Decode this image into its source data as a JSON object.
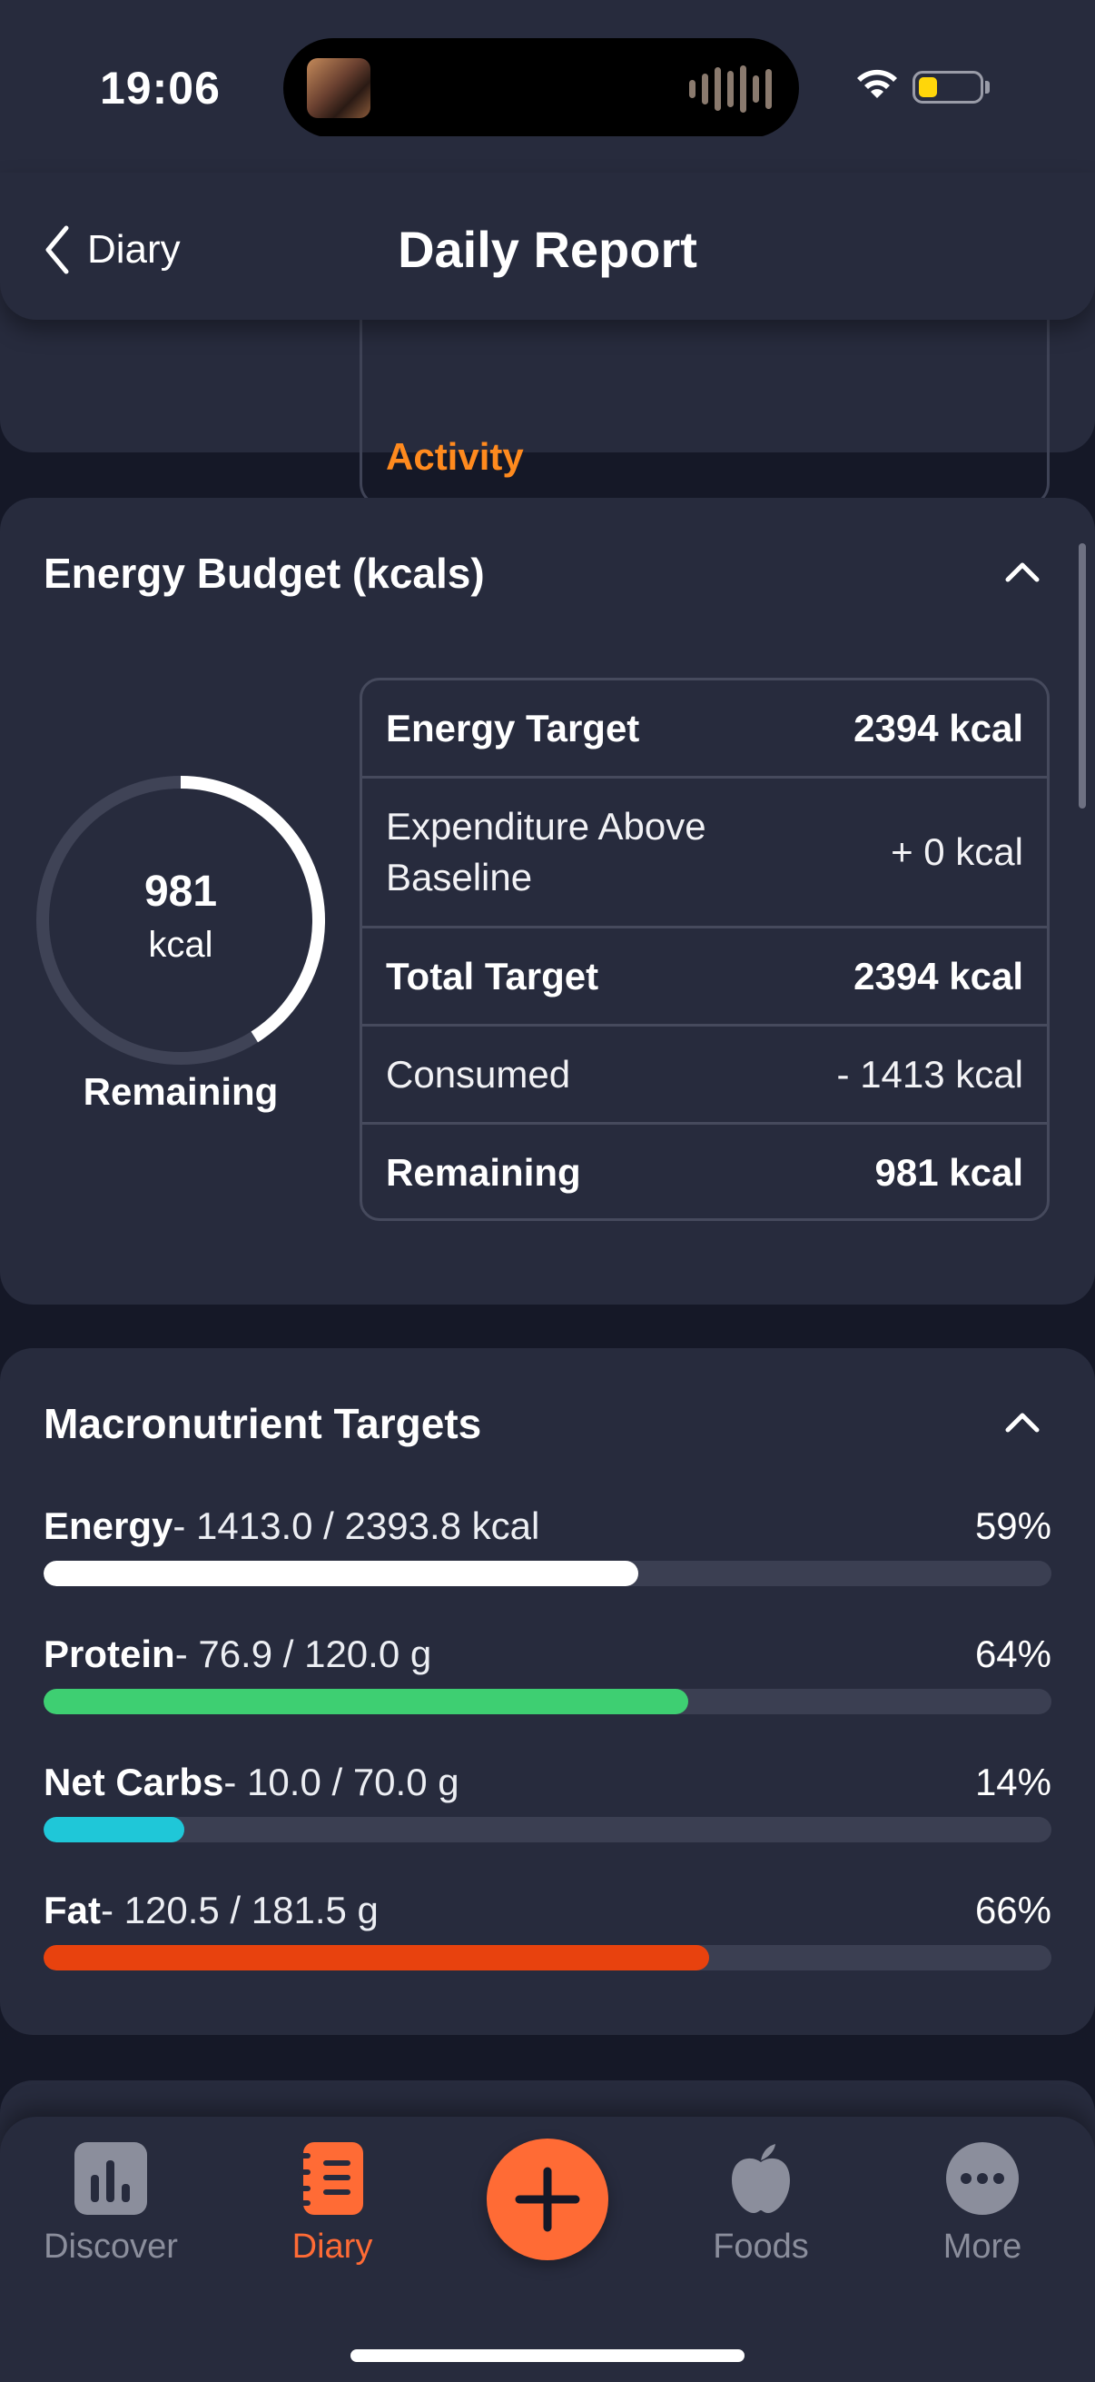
{
  "status_bar": {
    "time": "19:06"
  },
  "header": {
    "back_label": "Diary",
    "title": "Daily Report"
  },
  "activity_card": {
    "label": "Activity"
  },
  "energy_budget": {
    "title": "Energy Budget (kcals)",
    "ring": {
      "value": "981",
      "unit": "kcal",
      "caption": "Remaining",
      "fraction_remaining": 0.41
    },
    "rows": [
      {
        "label": "Energy Target",
        "value": "2394 kcal",
        "bold": true
      },
      {
        "label": "Expenditure Above Baseline",
        "value": "+ 0 kcal",
        "bold": false
      },
      {
        "label": "Total Target",
        "value": "2394 kcal",
        "bold": true
      },
      {
        "label": "Consumed",
        "value": "- 1413 kcal",
        "bold": false
      },
      {
        "label": "Remaining",
        "value": "981 kcal",
        "bold": true
      }
    ]
  },
  "macros": {
    "title": "Macronutrient Targets",
    "items": [
      {
        "name": "Energy",
        "detail": "- 1413.0 / 2393.8 kcal",
        "percent": "59%",
        "fraction": 0.59,
        "color": "#ffffff"
      },
      {
        "name": "Protein",
        "detail": "- 76.9 / 120.0 g",
        "percent": "64%",
        "fraction": 0.64,
        "color": "#3ecf72"
      },
      {
        "name": "Net Carbs",
        "detail": "- 10.0 / 70.0 g",
        "percent": "14%",
        "fraction": 0.14,
        "color": "#1fc7d8"
      },
      {
        "name": "Fat",
        "detail": "- 120.5 / 181.5 g",
        "percent": "66%",
        "fraction": 0.66,
        "color": "#e8420e"
      }
    ]
  },
  "tab_bar": {
    "tabs": [
      {
        "label": "Discover",
        "icon": "bar-chart-icon",
        "active": false
      },
      {
        "label": "Diary",
        "icon": "notebook-icon",
        "active": true
      },
      {
        "label": "Foods",
        "icon": "apple-icon",
        "active": false
      },
      {
        "label": "More",
        "icon": "more-dots-icon",
        "active": false
      }
    ],
    "fab_icon": "plus-icon"
  },
  "colors": {
    "accent": "#ff6b35",
    "card": "#272b3d",
    "background": "#151827",
    "activity": "#ff8a1e"
  }
}
